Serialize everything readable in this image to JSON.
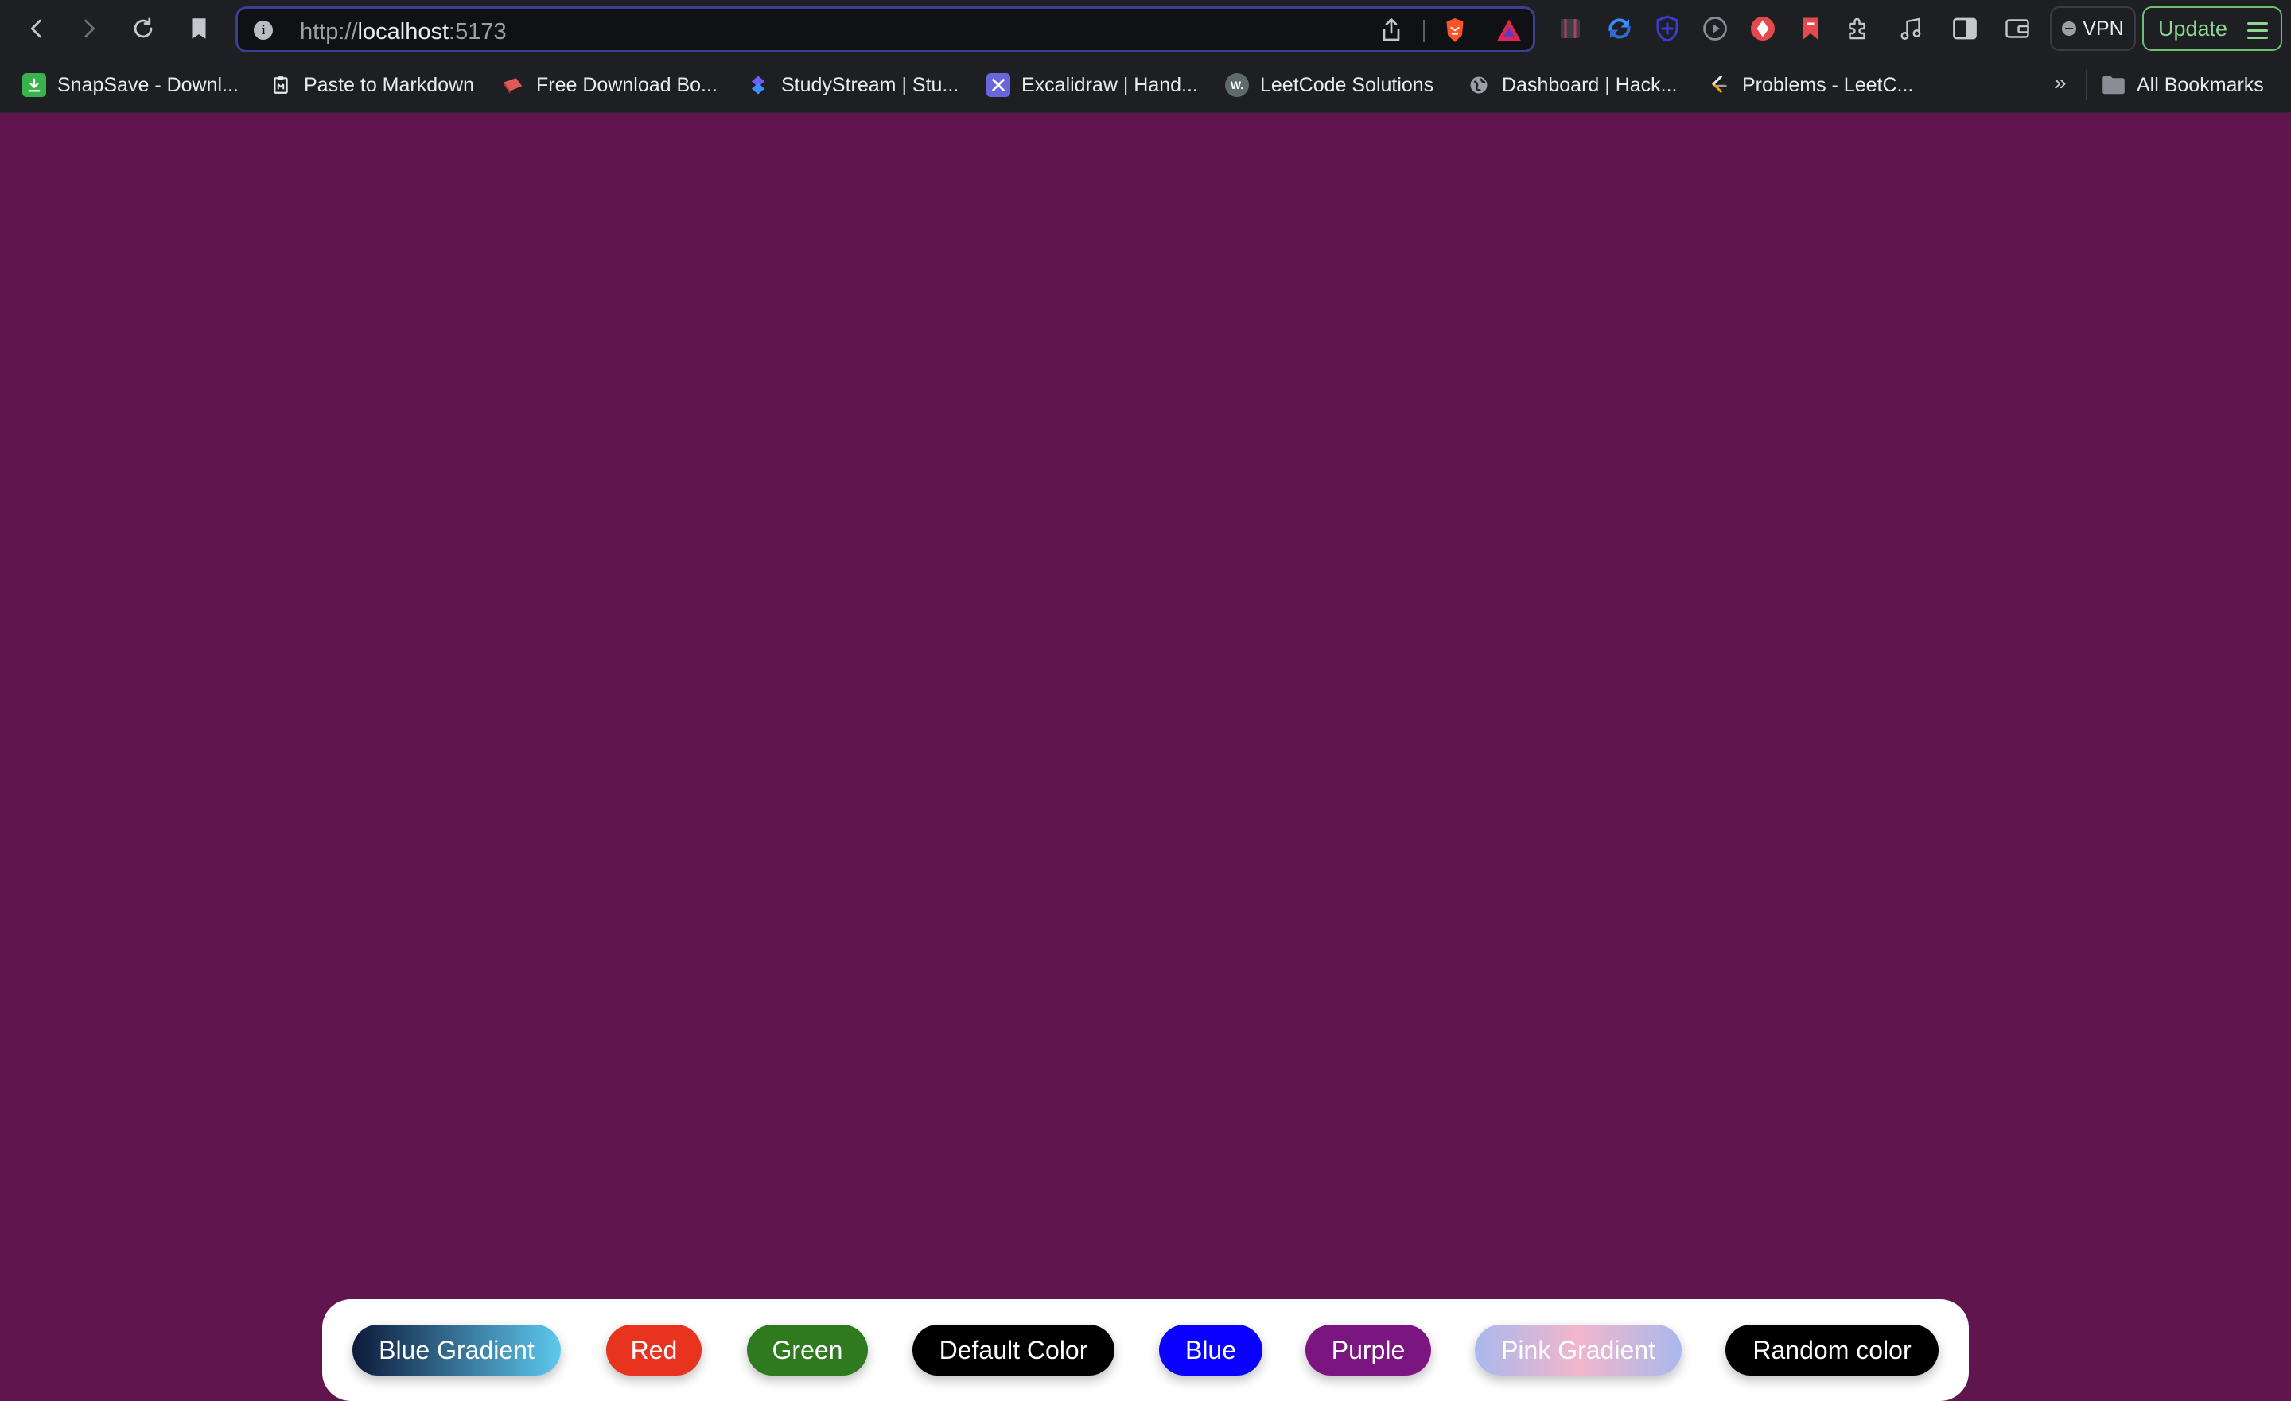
{
  "browser": {
    "url_scheme": "http://",
    "url_host": "localhost",
    "url_port": ":5173",
    "vpn_label": "VPN",
    "update_label": "Update"
  },
  "bookmarks": [
    {
      "label": "SnapSave - Downl...",
      "icon": "download-icon",
      "color": "#37b24d"
    },
    {
      "label": "Paste to Markdown",
      "icon": "clipboard-icon",
      "color": "#e8eaed"
    },
    {
      "label": "Free Download Bo...",
      "icon": "book-icon",
      "color": "#e05a5a"
    },
    {
      "label": "StudyStream | Stu...",
      "icon": "studystream-icon",
      "color": "#5b6cff"
    },
    {
      "label": "Excalidraw | Hand...",
      "icon": "excalidraw-icon",
      "color": "#6965db"
    },
    {
      "label": "LeetCode Solutions",
      "icon": "walkccc-icon",
      "color": "#5f6b6a"
    },
    {
      "label": "Dashboard | Hack...",
      "icon": "globe-icon",
      "color": "#9aa0a6"
    },
    {
      "label": "Problems - LeetC...",
      "icon": "leetcode-icon",
      "color": "#f0a500"
    }
  ],
  "bookmarks_overflow": "»",
  "all_bookmarks_label": "All Bookmarks",
  "page": {
    "background": "#61154f",
    "buttons": [
      {
        "label": "Blue Gradient",
        "bg": "linear-gradient(90deg, #0d1a3a, #5ec8ee)",
        "fg": "#ffffff"
      },
      {
        "label": "Red",
        "bg": "#e8331f",
        "fg": "#ffffff"
      },
      {
        "label": "Green",
        "bg": "#2f7a1e",
        "fg": "#ffffff"
      },
      {
        "label": "Default Color",
        "bg": "#000000",
        "fg": "#ffffff"
      },
      {
        "label": "Blue",
        "bg": "#0a00ff",
        "fg": "#ffffff"
      },
      {
        "label": "Purple",
        "bg": "#7b1680",
        "fg": "#ffffff"
      },
      {
        "label": "Pink Gradient",
        "bg": "linear-gradient(90deg, #a9b8ec, #f2b6cc, #a9b8ec)",
        "fg": "#ffffff"
      },
      {
        "label": "Random color",
        "bg": "#000000",
        "fg": "#ffffff"
      }
    ]
  }
}
